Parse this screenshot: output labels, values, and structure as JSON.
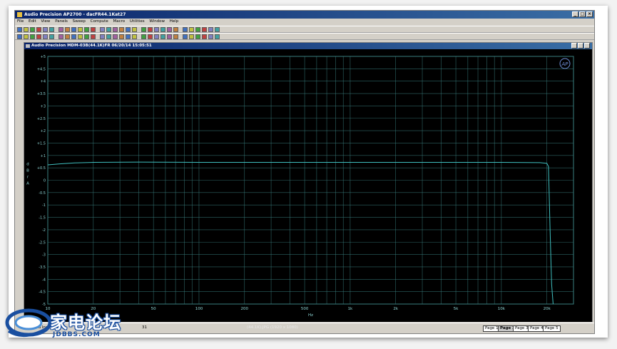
{
  "app": {
    "title": "Audio Precision AP2700 - dacFR44.1Kat27",
    "graph_title": "Audio Precision MDM-03B(44.1K)FR 06/20/14 15:05:51",
    "brand_badge": "AP"
  },
  "menu": [
    "File",
    "Edit",
    "View",
    "Panels",
    "Sweep",
    "Compute",
    "Macro",
    "Utilities",
    "Window",
    "Help"
  ],
  "statusbar": {
    "left_text": "cted Ind",
    "center_text": "(44.1K).JPG (1920 x 1080)",
    "number": "31",
    "pages": [
      "Page 1",
      "Page 2",
      "Page 3",
      "Page 4",
      "Page 5"
    ],
    "active_page": "Page 2"
  },
  "watermark": {
    "cn": "家电论坛",
    "en": "JDBBS.COM"
  },
  "colors": {
    "trace": "#3fbfbf",
    "grid": "#3a7f7f",
    "tick_text": "#8fd6d6",
    "background": "#000000"
  },
  "chart_data": {
    "type": "line",
    "title": "Audio Precision MDM-03B(44.1K)FR 06/20/14 15:05:51",
    "xlabel": "Hz",
    "ylabel": "d B r A",
    "xscale": "log",
    "xlim": [
      10,
      30000
    ],
    "ylim": [
      -5,
      5
    ],
    "xticks": [
      10,
      20,
      50,
      100,
      200,
      500,
      1000,
      2000,
      5000,
      10000,
      20000
    ],
    "xtick_labels": [
      "10",
      "20",
      "50",
      "100",
      "200",
      "500",
      "1k",
      "2k",
      "5k",
      "10k",
      "20k"
    ],
    "yticks": [
      5,
      4.5,
      4,
      3.5,
      3,
      2.5,
      2,
      1.5,
      1,
      0.5,
      0,
      -0.5,
      -1,
      -1.5,
      -2,
      -2.5,
      -3,
      -3.5,
      -4,
      -4.5,
      -5
    ],
    "ytick_labels": [
      "+5",
      "+4.5",
      "+4",
      "+3.5",
      "+3",
      "+2.5",
      "+2",
      "+1.5",
      "+1",
      "+0.5",
      "0",
      "-0.5",
      "-1",
      "-1.5",
      "-2",
      "-2.5",
      "-3",
      "-3.5",
      "-4",
      "-4.5",
      "-5"
    ],
    "grid": true,
    "series": [
      {
        "x": [
          10,
          12,
          15,
          20,
          40,
          100,
          1000,
          10000,
          18000,
          20000,
          20500,
          21000,
          21500,
          22000
        ],
        "y": [
          0.62,
          0.66,
          0.7,
          0.72,
          0.73,
          0.72,
          0.72,
          0.72,
          0.71,
          0.68,
          0.55,
          -2.0,
          -4.2,
          -5.0
        ]
      }
    ]
  }
}
